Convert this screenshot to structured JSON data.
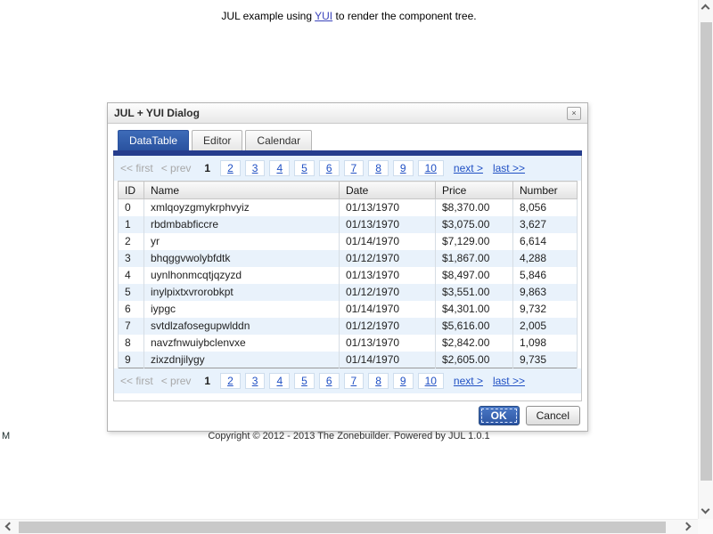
{
  "page": {
    "intro_prefix": "JUL example using ",
    "intro_link": "YUI",
    "intro_suffix": " to render the component tree.",
    "copyright": "Copyright © 2012 - 2013 The Zonebuilder. Powered by JUL 1.0.1",
    "stray_text": "M"
  },
  "dialog": {
    "title": "JUL + YUI Dialog",
    "close_glyph": "×",
    "tabs": [
      {
        "label": "DataTable",
        "active": true
      },
      {
        "label": "Editor",
        "active": false
      },
      {
        "label": "Calendar",
        "active": false
      }
    ],
    "paginator": {
      "first": "<< first",
      "prev": "< prev",
      "current": "1",
      "pages": [
        "2",
        "3",
        "4",
        "5",
        "6",
        "7",
        "8",
        "9",
        "10"
      ],
      "next": "next >",
      "last": "last >>"
    },
    "table": {
      "columns": [
        "ID",
        "Name",
        "Date",
        "Price",
        "Number"
      ],
      "rows": [
        [
          "0",
          "xmlqoyzgmykrphvyiz",
          "01/13/1970",
          "$8,370.00",
          "8,056"
        ],
        [
          "1",
          "rbdmbabficcre",
          "01/13/1970",
          "$3,075.00",
          "3,627"
        ],
        [
          "2",
          "yr",
          "01/14/1970",
          "$7,129.00",
          "6,614"
        ],
        [
          "3",
          "bhqggvwolybfdtk",
          "01/12/1970",
          "$1,867.00",
          "4,288"
        ],
        [
          "4",
          "uynlhonmcqtjqzyzd",
          "01/13/1970",
          "$8,497.00",
          "5,846"
        ],
        [
          "5",
          "inylpixtxvrorobkpt",
          "01/12/1970",
          "$3,551.00",
          "9,863"
        ],
        [
          "6",
          "iypgc",
          "01/14/1970",
          "$4,301.00",
          "9,732"
        ],
        [
          "7",
          "svtdlzafosegupwlddn",
          "01/12/1970",
          "$5,616.00",
          "2,005"
        ],
        [
          "8",
          "navzfnwuiybclenvxe",
          "01/13/1970",
          "$2,842.00",
          "1,098"
        ],
        [
          "9",
          "zixzdnjilygy",
          "01/14/1970",
          "$2,605.00",
          "9,735"
        ]
      ]
    },
    "buttons": {
      "ok": "OK",
      "cancel": "Cancel"
    }
  },
  "colors": {
    "active_tab": "#2a529f",
    "tab_underline_bar": "#263d8d",
    "paginator_background": "#e8f2fc",
    "alt_row_background": "#e9f2fb",
    "link_blue": "#2050c4",
    "ok_button_blue": "#3a66b0"
  }
}
